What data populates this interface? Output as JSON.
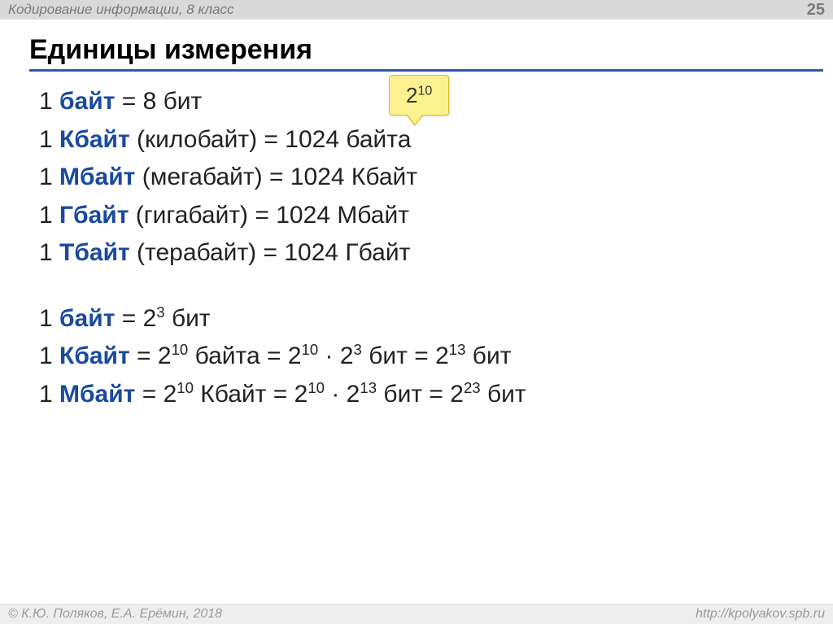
{
  "header": {
    "subject": "Кодирование информации, 8 класс",
    "page": "25"
  },
  "title": "Единицы измерения",
  "callout": {
    "base": "2",
    "exp": "10"
  },
  "lines1": [
    {
      "pre": "1 ",
      "unit": "байт",
      "rest": " = 8 бит"
    },
    {
      "pre": "1 ",
      "unit": "Кбайт",
      "rest": " (килобайт) = 1024 байта"
    },
    {
      "pre": "1 ",
      "unit": "Мбайт",
      "rest": " (мегабайт) = 1024 Кбайт"
    },
    {
      "pre": "1 ",
      "unit": "Гбайт",
      "rest": " (гигабайт) = 1024 Мбайт"
    },
    {
      "pre": "1 ",
      "unit": "Тбайт",
      "rest": " (терабайт) = 1024 Гбайт"
    }
  ],
  "lines2": {
    "l0": {
      "pre": "1 ",
      "unit": "байт",
      "a": " = 2",
      "aexp": "3",
      "b": " бит"
    },
    "l1": {
      "pre": "1 ",
      "unit": "Кбайт",
      "a": " = 2",
      "aexp": "10",
      "b": " байта = 2",
      "bexp": "10",
      "c": " · 2",
      "cexp": "3",
      "d": " бит = 2",
      "dexp": "13",
      "e": " бит"
    },
    "l2": {
      "pre": "1 ",
      "unit": "Мбайт",
      "a": " = 2",
      "aexp": "10",
      "b": " Кбайт = 2",
      "bexp": "10",
      "c": " · 2",
      "cexp": "13",
      "d": "  бит = 2",
      "dexp": "23",
      "e": " бит"
    }
  },
  "footer": {
    "left": "© К.Ю. Поляков, Е.А. Ерёмин, 2018",
    "right": "http://kpolyakov.spb.ru"
  }
}
